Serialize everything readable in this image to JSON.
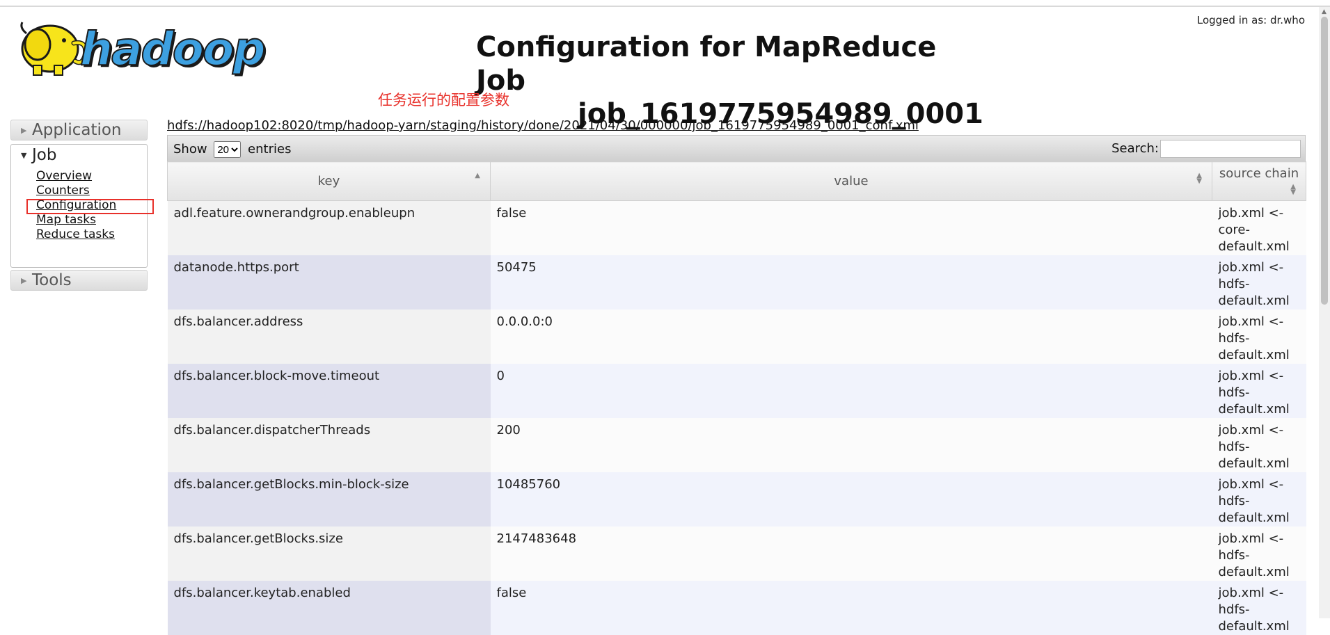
{
  "header": {
    "logged_in": "Logged in as: dr.who",
    "title_line1": "Configuration for MapReduce Job",
    "title_line2": "job_1619775954989_0001",
    "annotation": "任务运行的配置参数",
    "logo_text": "hadoop"
  },
  "sidebar": {
    "application": "Application",
    "job": "Job",
    "job_items": [
      "Overview",
      "Counters",
      "Configuration",
      "Map tasks",
      "Reduce tasks"
    ],
    "tools": "Tools"
  },
  "main": {
    "conf_path": "hdfs://hadoop102:8020/tmp/hadoop-yarn/staging/history/done/2021/04/30/000000/job_1619775954989_0001_conf.xml",
    "show_label": "Show",
    "entries_label": "entries",
    "page_size": "20",
    "search_label": "Search:",
    "columns": [
      "key",
      "value",
      "source chain"
    ],
    "rows": [
      {
        "key": "adl.feature.ownerandgroup.enableupn",
        "value": "false",
        "source": [
          "job.xml <-",
          "core-",
          "default.xml"
        ]
      },
      {
        "key": "datanode.https.port",
        "value": "50475",
        "source": [
          "job.xml <-",
          "hdfs-",
          "default.xml"
        ]
      },
      {
        "key": "dfs.balancer.address",
        "value": "0.0.0.0:0",
        "source": [
          "job.xml <-",
          "hdfs-",
          "default.xml"
        ]
      },
      {
        "key": "dfs.balancer.block-move.timeout",
        "value": "0",
        "source": [
          "job.xml <-",
          "hdfs-",
          "default.xml"
        ]
      },
      {
        "key": "dfs.balancer.dispatcherThreads",
        "value": "200",
        "source": [
          "job.xml <-",
          "hdfs-",
          "default.xml"
        ]
      },
      {
        "key": "dfs.balancer.getBlocks.min-block-size",
        "value": "10485760",
        "source": [
          "job.xml <-",
          "hdfs-",
          "default.xml"
        ]
      },
      {
        "key": "dfs.balancer.getBlocks.size",
        "value": "2147483648",
        "source": [
          "job.xml <-",
          "hdfs-",
          "default.xml"
        ]
      },
      {
        "key": "dfs.balancer.keytab.enabled",
        "value": "false",
        "source": [
          "job.xml <-",
          "hdfs-",
          "default.xml"
        ]
      }
    ]
  },
  "colors": {
    "annotation": "#e8302a",
    "logo_yellow": "#f7e41b",
    "logo_blue": "#1d6fa8"
  }
}
